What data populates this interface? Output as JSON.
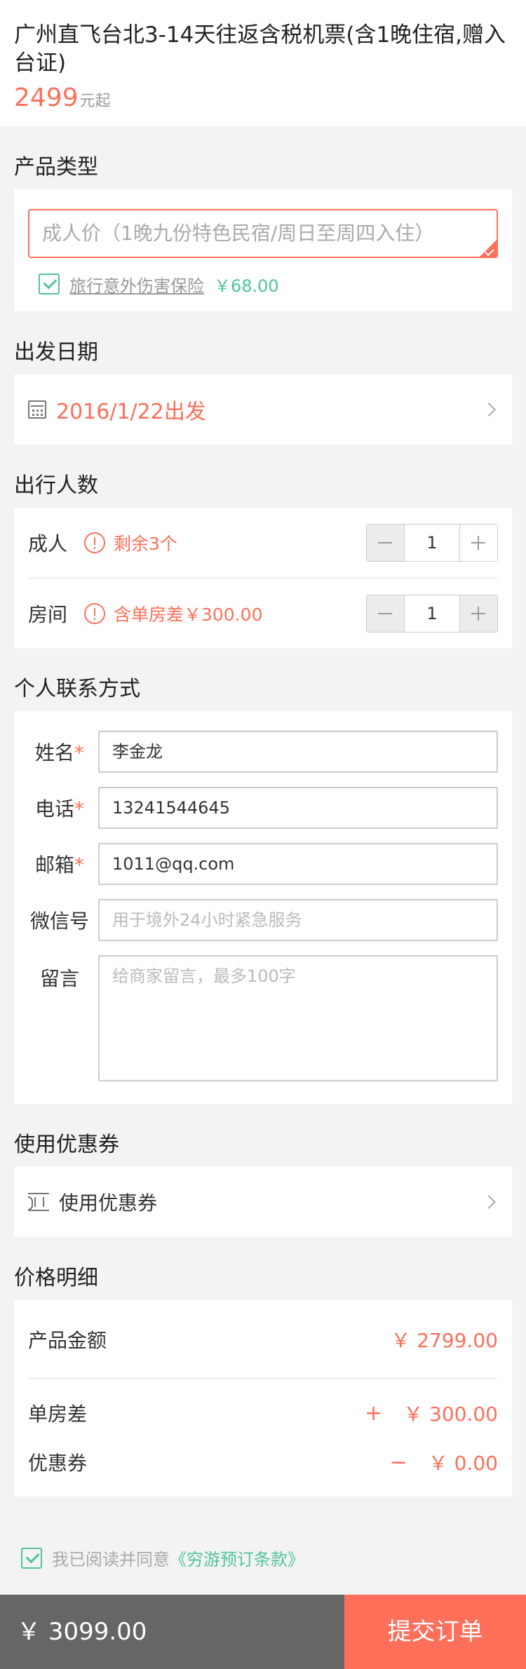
{
  "product": {
    "title": "广州直飞台北3-14天往返含税机票(含1晚住宿,赠入台证)",
    "price": "2499",
    "price_suffix": "元起"
  },
  "sections": {
    "product_type": "产品类型",
    "departure_date": "出发日期",
    "travelers": "出行人数",
    "contact": "个人联系方式",
    "coupon": "使用优惠券",
    "price_detail": "价格明细"
  },
  "product_type": {
    "selected": "成人价（1晚九份特色民宿/周日至周四入住）",
    "insurance_name": "旅行意外伤害保险",
    "insurance_price": "￥68.00"
  },
  "departure": {
    "date": "2016/1/22出发"
  },
  "travelers": {
    "adult_label": "成人",
    "adult_note": "剩余3个",
    "adult_count": "1",
    "room_label": "房间",
    "room_note": "含单房差￥300.00",
    "room_count": "1"
  },
  "contact": {
    "name_label": "姓名",
    "name_value": "李金龙",
    "phone_label": "电话",
    "phone_value": "13241544645",
    "email_label": "邮箱",
    "email_value": "1011@qq.com",
    "wechat_label": "微信号",
    "wechat_placeholder": "用于境外24小时紧急服务",
    "message_label": "留言",
    "message_placeholder": "给商家留言，最多100字",
    "required_mark": "*"
  },
  "coupon": {
    "label": "使用优惠券"
  },
  "price_detail": {
    "product_label": "产品金额",
    "product_value": "￥ 2799.00",
    "single_room_label": "单房差",
    "single_room_sign": "+",
    "single_room_value": "￥ 300.00",
    "coupon_label": "优惠券",
    "coupon_sign": "−",
    "coupon_value": "￥ 0.00"
  },
  "agreement": {
    "text": "我已阅读并同意",
    "link": "《穷游预订条款》"
  },
  "footer": {
    "total": "￥ 3099.00",
    "submit": "提交订单"
  },
  "colors": {
    "accent": "#ff6f5a",
    "green": "#4fc39b",
    "footer_bg": "#666666"
  }
}
